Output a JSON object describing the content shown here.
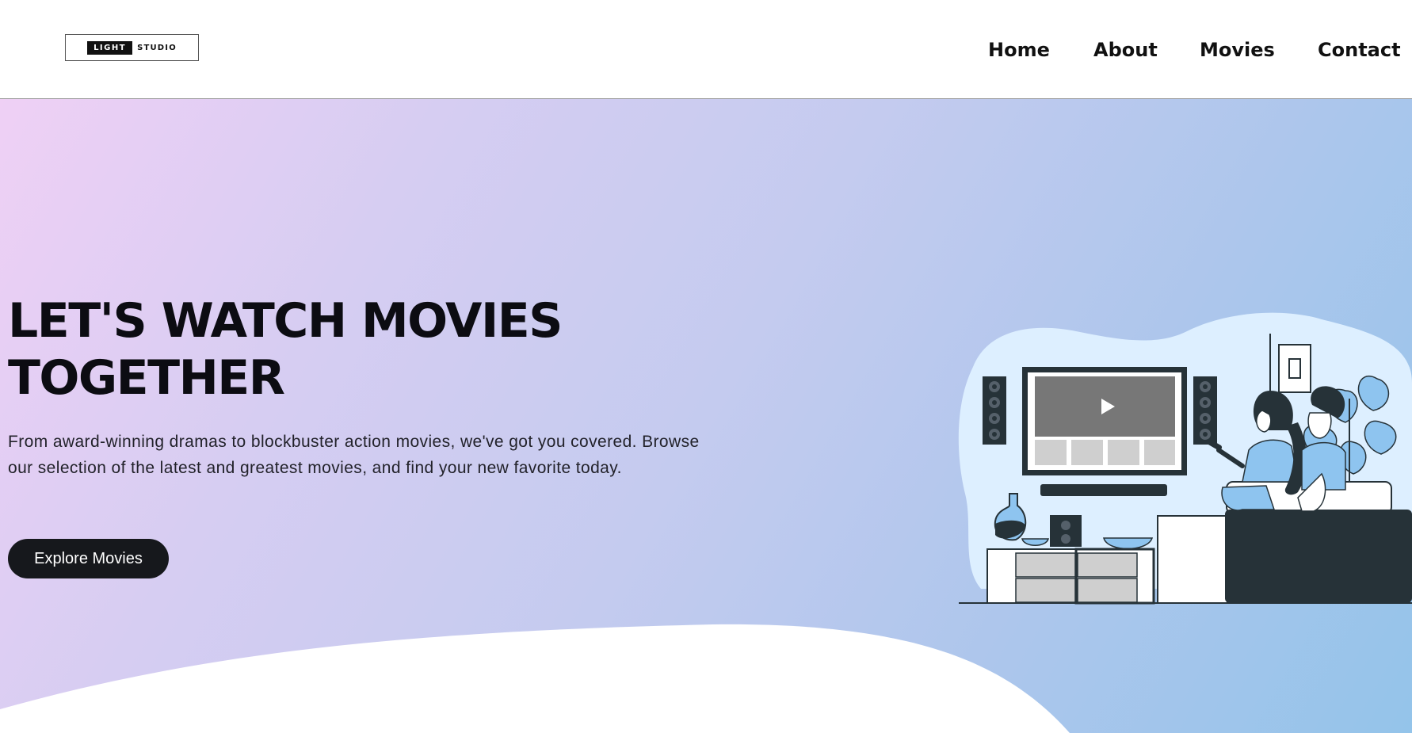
{
  "brand": {
    "logo_left": "LIGHT",
    "logo_right": "STUDIO"
  },
  "nav": {
    "items": [
      {
        "label": "Home"
      },
      {
        "label": "About"
      },
      {
        "label": "Movies"
      },
      {
        "label": "Contact"
      }
    ]
  },
  "hero": {
    "title_line1": "LET'S WATCH MOVIES",
    "title_line2": "TOGETHER",
    "description_line1": "From award-winning dramas to blockbuster action movies, we've got you covered. Browse",
    "description_line2": "our selection of the latest and greatest movies, and find your new favorite today.",
    "cta_label": "Explore Movies",
    "illustration_icon": "couple-watching-tv-illustration"
  },
  "colors": {
    "gradient_start": "#efd0f5",
    "gradient_end": "#94c4ea",
    "text_dark": "#0c0c12",
    "button_bg": "#16181c",
    "illustration_dark": "#263238",
    "illustration_blue": "#8ec4ef"
  }
}
